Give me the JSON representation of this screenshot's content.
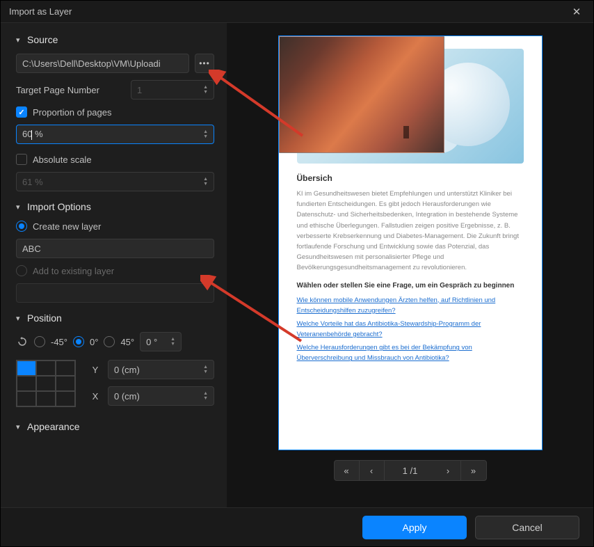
{
  "titlebar": {
    "title": "Import as Layer"
  },
  "sections": {
    "source": "Source",
    "import_options": "Import Options",
    "position": "Position",
    "appearance": "Appearance"
  },
  "source": {
    "path": "C:\\Users\\Dell\\Desktop\\VM\\Uploadi",
    "target_page_label": "Target Page Number",
    "target_page_value": "1",
    "proportion_label": "Proportion of pages",
    "proportion_checked": true,
    "proportion_value": "60 %",
    "absolute_label": "Absolute scale",
    "absolute_checked": false,
    "absolute_value": "61 %"
  },
  "import_options": {
    "create_label": "Create new layer",
    "create_checked": true,
    "layer_name": "ABC",
    "add_label": "Add to existing layer",
    "add_checked": false
  },
  "position": {
    "neg45": "-45°",
    "zero": "0°",
    "pos45": "45°",
    "custom_angle": "0 °",
    "y_label": "Y",
    "y_value": "0 (cm)",
    "x_label": "X",
    "x_value": "0 (cm)"
  },
  "preview": {
    "heading": "Übersich",
    "body": "KI im Gesundheitswesen bietet Empfehlungen und unterstützt Kliniker bei fundierten Entscheidungen.   Es gibt jedoch Herausforderungen wie Datenschutz- und Sicherheitsbedenken, Integration in bestehende Systeme und ethische Überlegungen. Fallstudien zeigen positive Ergebnisse, z. B.   verbesserte Krebserkennung und Diabetes-Management. Die Zukunft bringt fortlaufende Forschung   und Entwicklung sowie das Potenzial, das Gesundheitswesen mit personalisierter Pflege und Bevölkerungsgesundheitsmanagement zu revolutionieren.",
    "subheading": "Wählen oder stellen Sie eine Frage, um ein Gespräch zu beginnen",
    "links": [
      "Wie können mobile Anwendungen Ärzten helfen, auf Richtlinien und Entscheidungshilfen zuzugreifen?  ",
      "Welche Vorteile hat das Antibiotika-Stewardship-Programm der Veteranenbehörde gebracht?  ",
      "Welche Herausforderungen gibt es bei der Bekämpfung von Überverschreibung und Missbrauch von   Antibiotika?"
    ]
  },
  "page_nav": {
    "indicator": "1 /1"
  },
  "footer": {
    "apply": "Apply",
    "cancel": "Cancel"
  },
  "colors": {
    "accent": "#0a84ff",
    "arrow": "#d43a2a"
  }
}
